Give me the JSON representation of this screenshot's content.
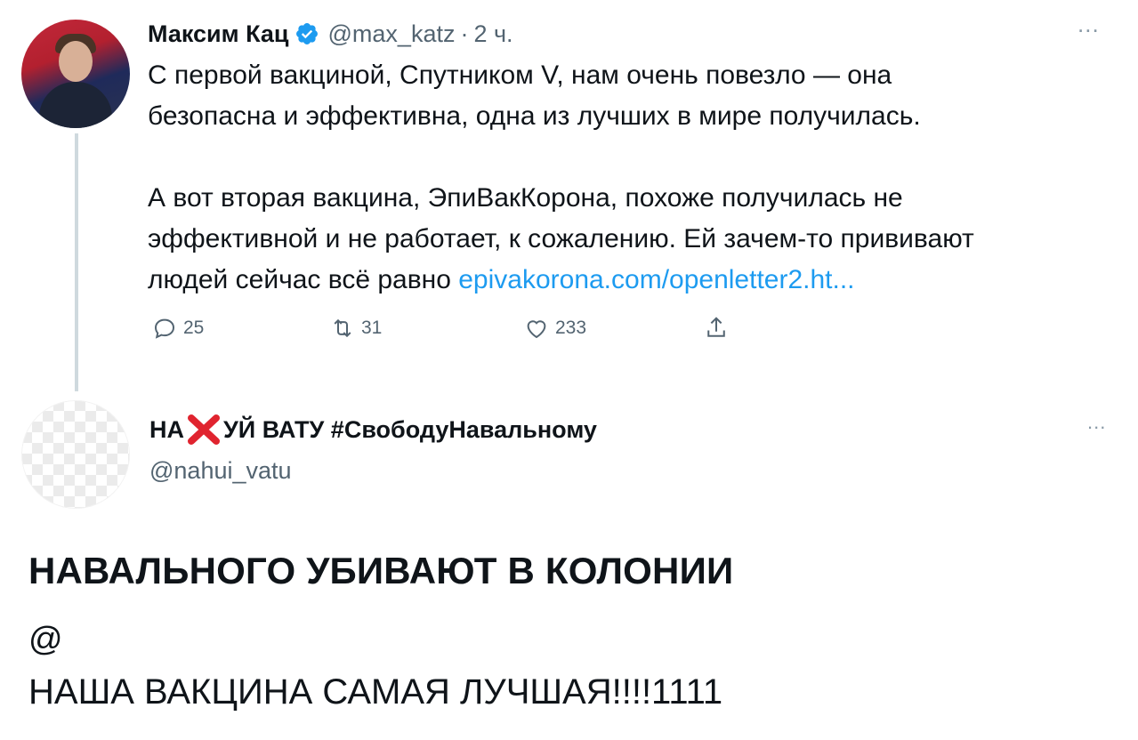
{
  "tweet1": {
    "name": "Максим Кац",
    "handle": "@max_katz",
    "dot": "·",
    "time": "2 ч.",
    "more": "...",
    "text": {
      "line1": "С первой вакциной, Спутником V, нам очень повезло — она",
      "line2": "безопасна и эффективна, одна из лучших в мире получилась.",
      "line3": "А вот вторая вакцина, ЭпиВакКорона, похоже получилась не",
      "line4": "эффективной и не работает, к сожалению. Ей зачем-то прививают",
      "line5_prefix": "людей сейчас всё равно ",
      "link": "epivakorona.com/openletter2.ht..."
    },
    "actions": {
      "replies": "25",
      "retweets": "31",
      "likes": "233"
    },
    "colors": {
      "link": "#1d9bf0",
      "verified": "#1d9bf0",
      "secondary": "#536471"
    }
  },
  "tweet2": {
    "name_prefix": "НА",
    "name_suffix": "УЙ ВАТУ #СвободуНавальному",
    "handle": "@nahui_vatu",
    "more": "...",
    "text": {
      "line1": "НАВАЛЬНОГО УБИВАЮТ В КОЛОНИИ",
      "line2": "@",
      "line3": "НАША ВАКЦИНА САМАЯ ЛУЧШАЯ!!!!1111"
    },
    "colors": {
      "cross": "#e0242f"
    }
  }
}
